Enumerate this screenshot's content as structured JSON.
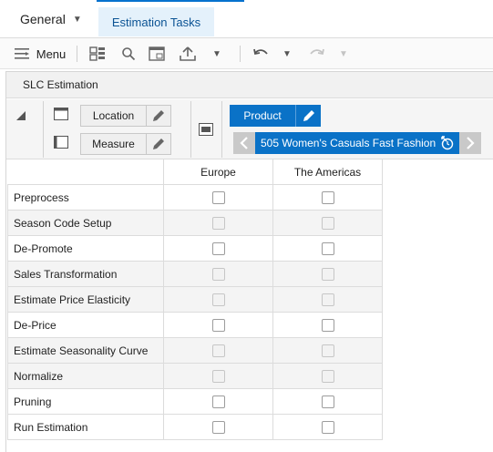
{
  "tabs": {
    "general_label": "General",
    "estimation_label": "Estimation Tasks"
  },
  "toolbar": {
    "menu_label": "Menu"
  },
  "panel": {
    "title": "SLC Estimation"
  },
  "pov": {
    "location_label": "Location",
    "measure_label": "Measure",
    "product_label": "Product",
    "product_member": "505 Women's Casuals Fast Fashion"
  },
  "grid": {
    "columns": [
      "Europe",
      "The Americas"
    ],
    "rows": [
      {
        "label": "Preprocess",
        "editable": true
      },
      {
        "label": "Season Code Setup",
        "editable": false
      },
      {
        "label": "De-Promote",
        "editable": true
      },
      {
        "label": "Sales Transformation",
        "editable": false
      },
      {
        "label": "Estimate Price Elasticity",
        "editable": false
      },
      {
        "label": "De-Price",
        "editable": true
      },
      {
        "label": "Estimate Seasonality Curve",
        "editable": false
      },
      {
        "label": "Normalize",
        "editable": false
      },
      {
        "label": "Pruning",
        "editable": true
      },
      {
        "label": "Run Estimation",
        "editable": true
      }
    ]
  },
  "colors": {
    "accent": "#0a72c7",
    "tab_selected_bg": "#e4f1fb",
    "readonly_row_bg": "#f4f4f4"
  }
}
